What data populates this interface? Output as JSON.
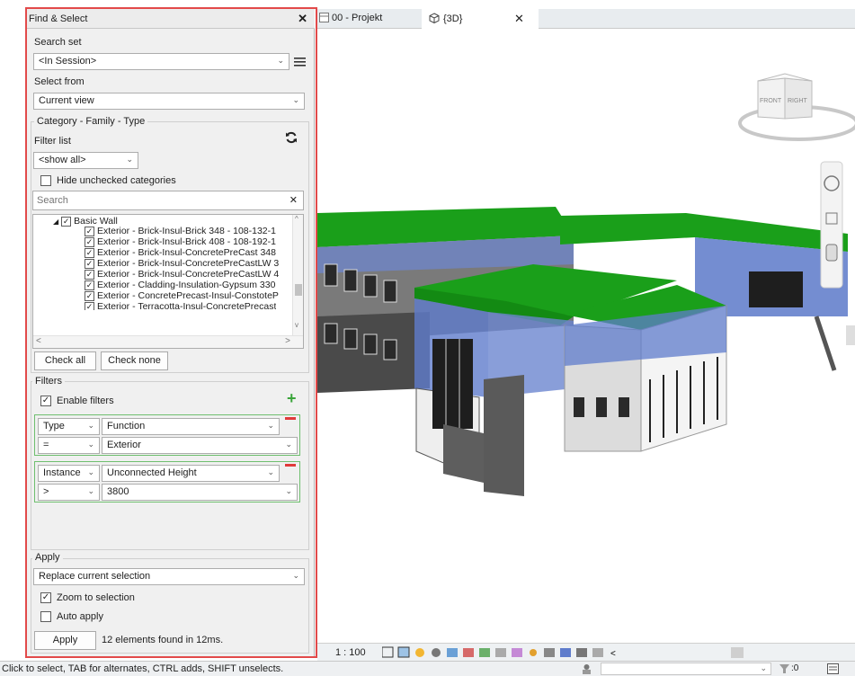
{
  "panel": {
    "title": "Find & Select",
    "close_glyph": "✕",
    "search_set": {
      "label": "Search set",
      "value": "<In Session>"
    },
    "select_from": {
      "label": "Select from",
      "value": "Current view"
    },
    "cft": {
      "group_label": "Category - Family - Type",
      "filter_list_label": "Filter list",
      "filter_list_value": "<show all>",
      "hide_unchecked_label": "Hide unchecked categories",
      "search_placeholder": "Search",
      "tree": {
        "parent": "Basic Wall",
        "children": [
          "Exterior - Brick-Insul-Brick 348 - 108-132-1",
          "Exterior - Brick-Insul-Brick 408 - 108-192-1",
          "Exterior - Brick-Insul-ConcretePreCast 348",
          "Exterior - Brick-Insul-ConcretePreCastLW 3",
          "Exterior - Brick-Insul-ConcretePreCastLW 4",
          "Exterior - Cladding-Insulation-Gypsum 330",
          "Exterior - ConcretePrecast-Insul-ConstoteP",
          "Exterior - Terracotta-Insul-ConcretePrecast"
        ]
      },
      "check_all": "Check all",
      "check_none": "Check none"
    },
    "filters": {
      "group_label": "Filters",
      "enable_label": "Enable filters",
      "rules": [
        {
          "scope": "Type",
          "parameter": "Function",
          "operator": "=",
          "value": "Exterior"
        },
        {
          "scope": "Instance",
          "parameter": "Unconnected Height",
          "operator": ">",
          "value": "3800"
        }
      ]
    },
    "apply": {
      "group_label": "Apply",
      "mode": "Replace current selection",
      "zoom_label": "Zoom to selection",
      "auto_apply_label": "Auto apply",
      "button": "Apply",
      "result": "12 elements found in 12ms."
    }
  },
  "tabs": [
    {
      "label": "00 - Projekt"
    },
    {
      "label": "{3D}"
    }
  ],
  "viewcube": {
    "front": "FRONT",
    "right": "RIGHT"
  },
  "view_bar": {
    "scale": "1 : 100"
  },
  "status": {
    "text": "Click to select, TAB for alternates, CTRL adds, SHIFT unselects.",
    "count": ":0"
  },
  "colors": {
    "roof": "#1aa81a",
    "selection": "#3b5fd0",
    "highlight_frame": "#e24a4a",
    "add_green": "#3aa43a"
  }
}
